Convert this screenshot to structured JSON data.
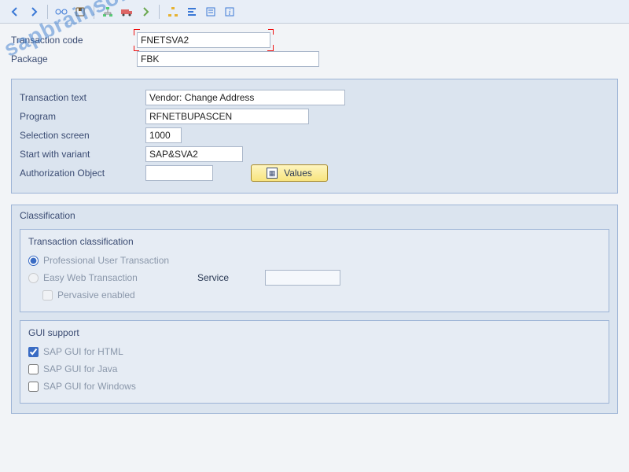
{
  "toolbar": {
    "icons": [
      "back",
      "forward",
      "save",
      "undo",
      "redo",
      "copy",
      "cut",
      "paste",
      "tree",
      "align",
      "list",
      "info"
    ]
  },
  "header": {
    "tcode_label": "Transaction code",
    "tcode_value": "FNETSVA2",
    "package_label": "Package",
    "package_value": "FBK"
  },
  "details": {
    "trans_text_label": "Transaction text",
    "trans_text_value": "Vendor: Change Address",
    "program_label": "Program",
    "program_value": "RFNETBUPASCEN",
    "sel_screen_label": "Selection screen",
    "sel_screen_value": "1000",
    "variant_label": "Start with variant",
    "variant_value": "SAP&SVA2",
    "authobj_label": "Authorization Object",
    "authobj_value": "",
    "values_btn": "Values"
  },
  "classification": {
    "title": "Classification",
    "tclass_title": "Transaction classification",
    "opt_professional": "Professional User Transaction",
    "opt_easy": "Easy Web Transaction",
    "service_label": "Service",
    "service_value": "",
    "opt_pervasive": "Pervasive enabled",
    "gui_title": "GUI support",
    "gui_html": "SAP GUI for HTML",
    "gui_java": "SAP GUI for Java",
    "gui_windows": "SAP GUI for Windows"
  },
  "watermark": "sapbrainsonline.com"
}
